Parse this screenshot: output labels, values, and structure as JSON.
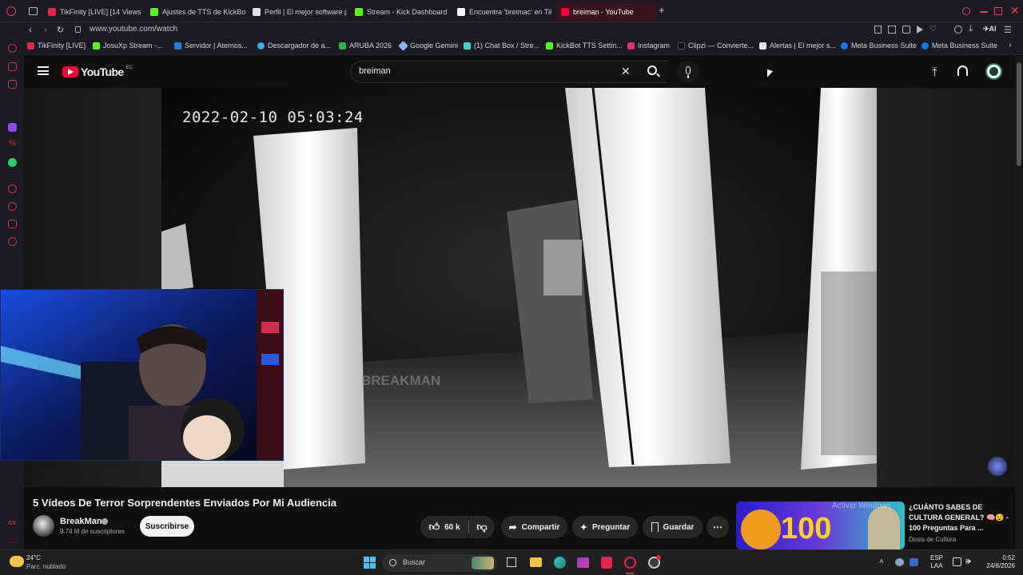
{
  "browser": {
    "tabs": [
      {
        "label": "TikFinity [LIVE] [14 Views",
        "color": "#e5254b"
      },
      {
        "label": "Ajustes de TTS de KickBot",
        "color": "#53fc18"
      },
      {
        "label": "Perfil | El mejor software p",
        "color": "#e4e4e4"
      },
      {
        "label": "Stream - Kick Dashboard",
        "color": "#53fc18"
      },
      {
        "label": "Encuentra 'breimac' en Tik",
        "color": "#fff"
      },
      {
        "label": "breiman - YouTube",
        "color": "#ff0033"
      }
    ],
    "url": "www.youtube.com/watch",
    "bookmarks": [
      {
        "label": "TikFinity [LIVE]",
        "color": "#e5254b"
      },
      {
        "label": "JosuXp Stream -...",
        "color": "#53fc18"
      },
      {
        "label": "Servidor | Aternos...",
        "color": "#2a7de1"
      },
      {
        "label": "Descargador de a...",
        "color": "#3bb0f0"
      },
      {
        "label": "ARUBA 2026",
        "color": "#2db34a"
      },
      {
        "label": "Google Gemini",
        "color": "#8ab4f8"
      },
      {
        "label": "(1) Chat Box / Stre...",
        "color": "#4ad1c6"
      },
      {
        "label": "KickBot TTS Settin...",
        "color": "#53fc18"
      },
      {
        "label": "Instagram",
        "color": "#e1306c"
      },
      {
        "label": "Clipzi — Convierte...",
        "color": "#111"
      },
      {
        "label": "Alertas | El mejor s...",
        "color": "#e4e4e4"
      },
      {
        "label": "Meta Business Suite",
        "color": "#1877f2"
      },
      {
        "label": "Meta Business Suite",
        "color": "#1877f2"
      }
    ]
  },
  "youtube": {
    "logo": "YouTube",
    "region": "EC",
    "search_value": "breiman",
    "video": {
      "timestamp_overlay": "2022-02-10 05:03:24",
      "watermark": "BREAKMAN",
      "title": "5 Vídeos De Terror Sorprendentes Enviados Por Mi Audiencia"
    },
    "channel": {
      "name": "BreakMan",
      "subscribers": "9.74 M de suscriptores",
      "subscribe_label": "Suscribirse"
    },
    "actions": {
      "likes": "60 k",
      "share": "Compartir",
      "ask": "Preguntar",
      "save": "Guardar"
    },
    "recommended": {
      "thumb_number": "100",
      "title": "¿CUÁNTO SABES DE CULTURA GENERAL? 🧠😵 - 100 Preguntas Para ...",
      "channel": "Dosis de Cultura",
      "overlay": "Activar Windows"
    },
    "accent": "#ff0033"
  },
  "taskbar": {
    "weather_temp": "24°C",
    "weather_desc": "Parc. nublado",
    "search_placeholder": "Buscar",
    "lang_line1": "ESP",
    "lang_line2": "LAA",
    "time": "0:52",
    "date": "24/8/2026"
  }
}
